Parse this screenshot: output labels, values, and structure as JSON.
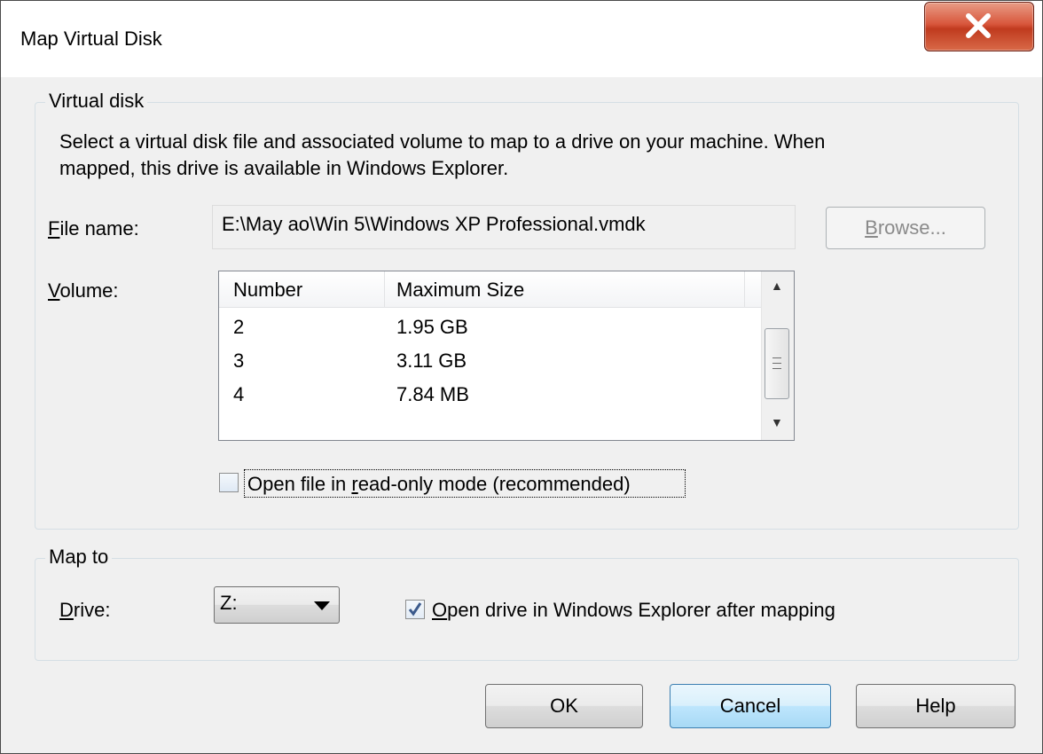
{
  "window": {
    "title": "Map Virtual Disk"
  },
  "virtual_disk": {
    "legend": "Virtual disk",
    "description_line1": "Select a virtual disk file and associated volume to map to a drive on your machine. When",
    "description_line2": "mapped, this drive is available in Windows Explorer.",
    "file_name_label_u": "F",
    "file_name_label_rest": "ile name:",
    "file_name_value": "E:\\May ao\\Win 5\\Windows XP Professional.vmdk",
    "browse_label_u": "B",
    "browse_label_rest": "rowse...",
    "volume_label_u": "V",
    "volume_label_rest": "olume:",
    "columns": [
      "Number",
      "Maximum Size"
    ],
    "rows": [
      {
        "number": "2",
        "size": "1.95 GB"
      },
      {
        "number": "3",
        "size": "3.11 GB"
      },
      {
        "number": "4",
        "size": "7.84 MB"
      }
    ],
    "readonly_checked": false,
    "readonly_label_pre": "Open file in ",
    "readonly_label_u": "r",
    "readonly_label_rest": "ead-only mode (recommended)"
  },
  "map_to": {
    "legend": "Map to",
    "drive_label_u": "D",
    "drive_label_rest": "rive:",
    "drive_value": "Z:",
    "open_explorer_checked": true,
    "open_explorer_label_u": "O",
    "open_explorer_label_rest": "pen drive in Windows Explorer after mapping"
  },
  "buttons": {
    "ok": "OK",
    "cancel": "Cancel",
    "help": "Help"
  },
  "colors": {
    "close_button": "#c9452a",
    "checkmark": "#3b5a8c",
    "default_button_border": "#3c7fb1"
  }
}
